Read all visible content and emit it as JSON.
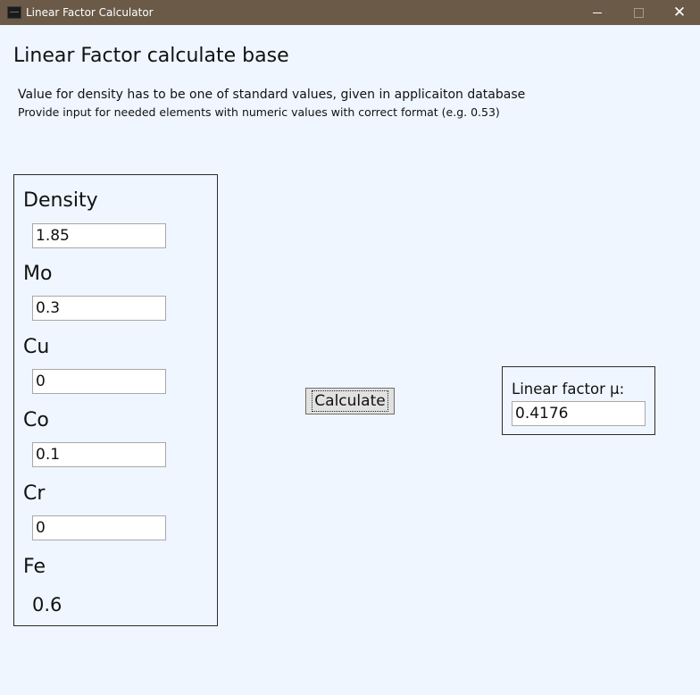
{
  "window": {
    "title": "Linear Factor Calculator",
    "close_glyph": "✕"
  },
  "main": {
    "heading": "Linear Factor calculate base",
    "info_line_1": "Value for density has to be one of standard values, given in applicaiton database",
    "info_line_2": "Provide input for needed elements with numeric values with correct format (e.g. 0.53)"
  },
  "inputs": {
    "density": {
      "label": "Density",
      "value": "1.85"
    },
    "mo": {
      "label": "Mo",
      "value": "0.3"
    },
    "cu": {
      "label": "Cu",
      "value": "0"
    },
    "co": {
      "label": "Co",
      "value": "0.1"
    },
    "cr": {
      "label": "Cr",
      "value": "0"
    },
    "fe": {
      "label": "Fe",
      "value": "0.6"
    }
  },
  "actions": {
    "calculate_label": "Calculate"
  },
  "result": {
    "label": "Linear factor µ:",
    "value": "0.4176"
  },
  "colors": {
    "titlebar": "#6b5a48",
    "background": "#eff6ff",
    "button_face": "#e1e1e1"
  },
  "icons": {
    "app": "app-icon",
    "minimize": "minimize-icon",
    "maximize": "maximize-icon",
    "close": "close-icon"
  }
}
